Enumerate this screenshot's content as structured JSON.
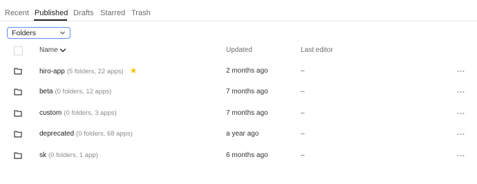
{
  "tabs": [
    {
      "label": "Recent",
      "active": false
    },
    {
      "label": "Published",
      "active": true
    },
    {
      "label": "Drafts",
      "active": false
    },
    {
      "label": "Starred",
      "active": false
    },
    {
      "label": "Trash",
      "active": false
    }
  ],
  "filter": {
    "selected": "Folders",
    "icon": "chevron-down-icon"
  },
  "table": {
    "columns": {
      "name": "Name",
      "updated": "Updated",
      "last_editor": "Last editor"
    },
    "rows": [
      {
        "name": "hiro-app",
        "meta": "(5 folders, 22 apps)",
        "starred": true,
        "updated": "2 months ago",
        "last_editor": "–"
      },
      {
        "name": "beta",
        "meta": "(0 folders, 12 apps)",
        "starred": false,
        "updated": "7 months ago",
        "last_editor": "–"
      },
      {
        "name": "custom",
        "meta": "(0 folders, 3 apps)",
        "starred": false,
        "updated": "7 months ago",
        "last_editor": "–"
      },
      {
        "name": "deprecated",
        "meta": "(0 folders, 68 apps)",
        "starred": false,
        "updated": "a year ago",
        "last_editor": "–"
      },
      {
        "name": "sk",
        "meta": "(0 folders, 1 app)",
        "starred": false,
        "updated": "6 months ago",
        "last_editor": "–"
      }
    ]
  },
  "colors": {
    "accent": "#5b8def",
    "star": "#f5c518",
    "text": "#1a1a1a",
    "muted": "#6b6b6b"
  }
}
